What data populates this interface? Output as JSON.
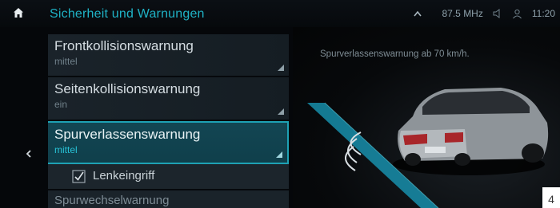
{
  "header": {
    "title": "Sicherheit und Warnungen",
    "radio_freq": "87.5 MHz",
    "time": "11:20"
  },
  "menu": {
    "items": [
      {
        "label": "Frontkollisionswarnung",
        "value": "mittel"
      },
      {
        "label": "Seitenkollisionswarnung",
        "value": "ein"
      },
      {
        "label": "Spurverlassenswarnung",
        "value": "mittel"
      }
    ],
    "sub_item": {
      "label": "Lenkeingriff",
      "checked": true
    },
    "next_item": {
      "label": "Spurwechselwarnung"
    }
  },
  "panel": {
    "info": "Spurverlassenswarnung ab 70 km/h.",
    "page_number": "4"
  },
  "colors": {
    "accent": "#1fb3c6",
    "selected_bg": "#134653",
    "background": "#05070a"
  },
  "icons": [
    "home-icon",
    "chevron-up-icon",
    "volume-icon",
    "user-icon",
    "back-arrow-icon",
    "checkbox-icon",
    "car-illustration"
  ]
}
